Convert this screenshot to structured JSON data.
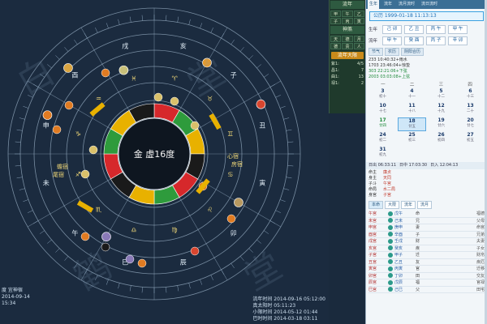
{
  "app": {
    "brand_color": "#1b2b3f",
    "accent": "#3aa0e0"
  },
  "watermarks": [
    "白",
    "鹤",
    "鸣",
    "霞",
    "堂",
    "天",
    "堂"
  ],
  "chart": {
    "center_label": "金 虚16度",
    "zodiac_signs": [
      "♈",
      "♉",
      "♊",
      "♋",
      "♌",
      "♍",
      "♎",
      "♏",
      "♐",
      "♑",
      "♒",
      "♓"
    ],
    "ring_labels": [
      "亥",
      "子",
      "丑",
      "寅",
      "卯",
      "辰",
      "巳",
      "午",
      "未",
      "申",
      "酉",
      "戌"
    ],
    "planet_icons": [
      "sun-icon",
      "moon-icon",
      "mercury-icon",
      "venus-icon",
      "mars-icon",
      "jupiter-icon",
      "saturn-icon"
    ],
    "side_labels": [
      "蟾宿",
      "尾宿",
      "心宿",
      "房宿"
    ]
  },
  "info_bottom_left": {
    "line1": "度 宜神宿",
    "line2": "2014-09-14",
    "line3": "15:34"
  },
  "info_bottom_right": {
    "row1_label": "流年时间",
    "row1_value": "2014-09-16 05:12:00",
    "row2_label": "真太阳时",
    "row2_value": "05:11:23",
    "row3_label": "小限时间",
    "row3_value": "2014-05-12 01:44",
    "row4_label": "巴时时间",
    "row4_value": "2014-03-18 03:11"
  },
  "mid_panel": {
    "head1": "流年",
    "grid1": [
      "甲",
      "午",
      "乙",
      "子",
      "丙",
      "寅"
    ],
    "head2": "神煞",
    "grid2": [
      "天",
      "德",
      "月",
      "德",
      "贵",
      "人"
    ],
    "button": "流年大限",
    "rows": [
      {
        "k": "紫1:",
        "v": "4/5"
      },
      {
        "k": "昌1:",
        "v": "7"
      },
      {
        "k": "曲1:",
        "v": "13"
      },
      {
        "k": "禄1:",
        "v": "2"
      }
    ]
  },
  "right_panel": {
    "tabs": [
      "生年",
      "流年",
      "流月流时",
      "流日流时"
    ],
    "date_box": "公历 1999-01-18 11:13:13",
    "pillars": [
      {
        "label": "生年",
        "cells": [
          "己 卯",
          "乙 丑",
          "丙 午",
          "甲 午"
        ]
      },
      {
        "label": "流年",
        "cells": [
          "甲 午",
          "癸 酉",
          "丙 子",
          "辛 卯"
        ]
      }
    ],
    "mini_tabs": [
      "节气",
      "农历",
      "阴阳合历"
    ],
    "terms": [
      {
        "text": "233 10:40:32+雨水",
        "green": false
      },
      {
        "text": "1703 23:46:04+惊蛰",
        "green": false
      },
      {
        "text": "303 22:21:06+下弦",
        "green": true
      },
      {
        "text": "2003 03:03:08+上弦",
        "green": true
      }
    ],
    "cal_head": [
      "一",
      "二",
      "三",
      "四"
    ],
    "calendar": [
      {
        "n": "3",
        "s": "初十",
        "g": false,
        "sel": false
      },
      {
        "n": "4",
        "s": "十一",
        "g": false,
        "sel": false
      },
      {
        "n": "5",
        "s": "十二",
        "g": false,
        "sel": false
      },
      {
        "n": "6",
        "s": "十三",
        "g": false,
        "sel": false
      },
      {
        "n": "10",
        "s": "十七",
        "g": false,
        "sel": false
      },
      {
        "n": "11",
        "s": "十八",
        "g": false,
        "sel": false
      },
      {
        "n": "12",
        "s": "十九",
        "g": false,
        "sel": false
      },
      {
        "n": "13",
        "s": "二十",
        "g": false,
        "sel": false
      },
      {
        "n": "17",
        "s": "廿四",
        "g": true,
        "sel": false
      },
      {
        "n": "18",
        "s": "廿五",
        "g": false,
        "sel": true
      },
      {
        "n": "19",
        "s": "廿六",
        "g": false,
        "sel": false
      },
      {
        "n": "20",
        "s": "廿七",
        "g": false,
        "sel": false
      },
      {
        "n": "24",
        "s": "初二",
        "g": false,
        "sel": false
      },
      {
        "n": "25",
        "s": "初三",
        "g": false,
        "sel": false
      },
      {
        "n": "26",
        "s": "初四",
        "g": false,
        "sel": false
      },
      {
        "n": "27",
        "s": "初五",
        "g": false,
        "sel": false
      },
      {
        "n": "31",
        "s": "初九",
        "g": false,
        "sel": false
      }
    ],
    "time_row": [
      "日出 06:33:11",
      "日中 17:03:30",
      "日入 12:04:13"
    ],
    "stars": [
      {
        "k": "命主",
        "v": "廉贞"
      },
      {
        "k": "身主",
        "v": "天同"
      },
      {
        "k": "子斗",
        "v": "午宫"
      },
      {
        "k": "命局",
        "v": "水二局"
      },
      {
        "k": "身宫",
        "v": "子宫"
      }
    ],
    "seg_tabs": [
      "本命",
      "大限",
      "流年",
      "流月"
    ],
    "palace": [
      {
        "a": "午宫",
        "b": "戊午",
        "c": "命",
        "d": "福德"
      },
      {
        "a": "未宫",
        "b": "己未",
        "c": "兄",
        "d": "父母"
      },
      {
        "a": "申宫",
        "b": "庚申",
        "c": "妻",
        "d": "命宫"
      },
      {
        "a": "酉宫",
        "b": "辛酉",
        "c": "子",
        "d": "兄弟"
      },
      {
        "a": "戌宫",
        "b": "壬戌",
        "c": "财",
        "d": "夫妻"
      },
      {
        "a": "亥宫",
        "b": "癸亥",
        "c": "疾",
        "d": "子女"
      },
      {
        "a": "子宫",
        "b": "甲子",
        "c": "迁",
        "d": "财帛"
      },
      {
        "a": "丑宫",
        "b": "乙丑",
        "c": "友",
        "d": "疾厄"
      },
      {
        "a": "寅宫",
        "b": "丙寅",
        "c": "官",
        "d": "迁移"
      },
      {
        "a": "卯宫",
        "b": "丁卯",
        "c": "田",
        "d": "交友"
      },
      {
        "a": "辰宫",
        "b": "戊辰",
        "c": "福",
        "d": "官禄"
      },
      {
        "a": "巳宫",
        "b": "己巳",
        "c": "父",
        "d": "田宅"
      }
    ]
  }
}
